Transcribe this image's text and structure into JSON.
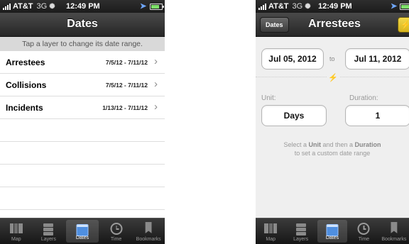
{
  "status_bar": {
    "carrier": "AT&T",
    "network": "3G",
    "time": "12:49 PM"
  },
  "left": {
    "title": "Dates",
    "hint": "Tap a layer to change its date range.",
    "rows": [
      {
        "name": "Arrestees",
        "range": "7/5/12 - 7/11/12"
      },
      {
        "name": "Collisions",
        "range": "7/5/12 - 7/11/12"
      },
      {
        "name": "Incidents",
        "range": "1/13/12 - 7/11/12"
      }
    ]
  },
  "right": {
    "title": "Arrestees",
    "back_label": "Dates",
    "start_date": "Jul 05, 2012",
    "to_label": "to",
    "end_date": "Jul 11, 2012",
    "unit_label": "Unit:",
    "duration_label": "Duration:",
    "unit_value": "Days",
    "duration_value": "1",
    "help_line1_a": "Select a ",
    "help_line1_b": "Unit",
    "help_line1_c": " and then a ",
    "help_line1_d": "Duration",
    "help_line2": "to set a custom date range"
  },
  "tabs": [
    {
      "label": "Map",
      "icon": "map-icon"
    },
    {
      "label": "Layers",
      "icon": "layers-icon"
    },
    {
      "label": "Dates",
      "icon": "calendar-icon"
    },
    {
      "label": "Time",
      "icon": "clock-icon"
    },
    {
      "label": "Bookmarks",
      "icon": "bookmark-icon"
    }
  ],
  "active_tab": "Dates",
  "colors": {
    "active_tab_icon": "#4f8fe0",
    "location_arrow": "#6fa8ff",
    "flash_button": "#e6c52f"
  }
}
